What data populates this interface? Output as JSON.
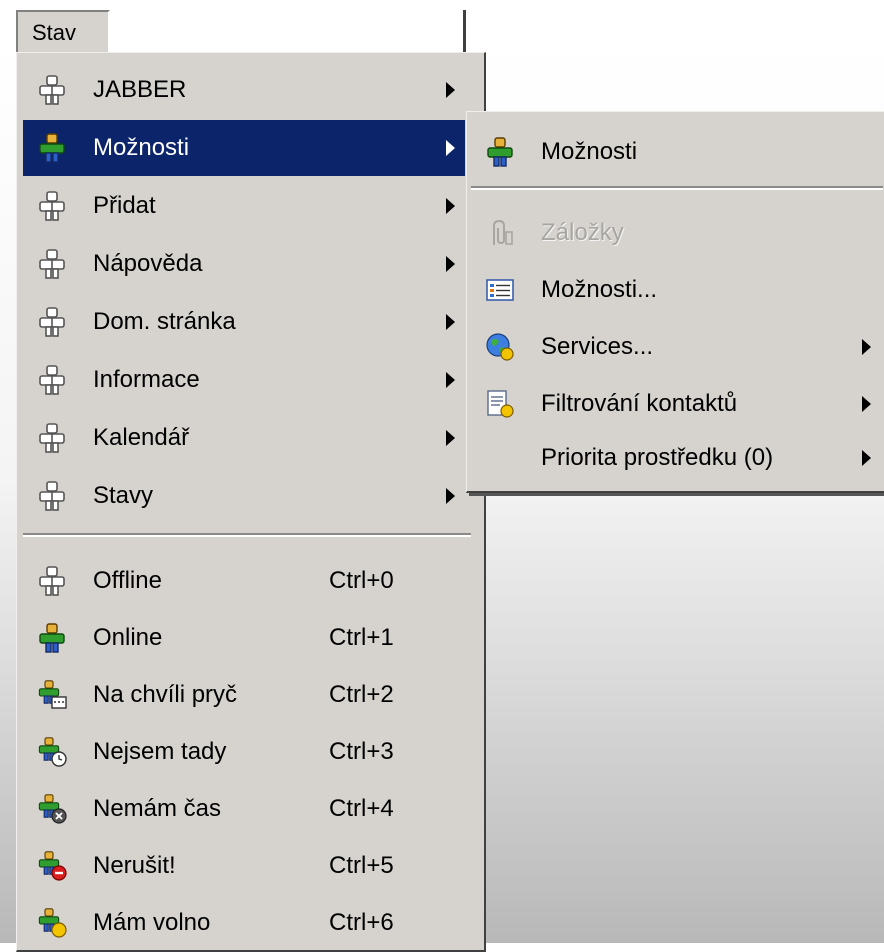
{
  "menubar": {
    "title": "Stav"
  },
  "main_menu": {
    "items": [
      {
        "label": "JABBER",
        "icon": "person-gray-icon",
        "has_submenu": true
      },
      {
        "label": "Možnosti",
        "icon": "person-color-icon",
        "has_submenu": true,
        "selected": true
      },
      {
        "label": "Přidat",
        "icon": "person-gray-icon",
        "has_submenu": true
      },
      {
        "label": "Nápověda",
        "icon": "person-gray-icon",
        "has_submenu": true
      },
      {
        "label": "Dom. stránka",
        "icon": "person-gray-icon",
        "has_submenu": true
      },
      {
        "label": "Informace",
        "icon": "person-gray-icon",
        "has_submenu": true
      },
      {
        "label": "Kalendář",
        "icon": "person-gray-icon",
        "has_submenu": true
      },
      {
        "label": "Stavy",
        "icon": "person-gray-icon",
        "has_submenu": true
      }
    ],
    "status_items": [
      {
        "label": "Offline",
        "shortcut": "Ctrl+0",
        "icon": "status-offline-icon"
      },
      {
        "label": "Online",
        "shortcut": "Ctrl+1",
        "icon": "status-online-icon"
      },
      {
        "label": "Na chvíli pryč",
        "shortcut": "Ctrl+2",
        "icon": "status-away-icon"
      },
      {
        "label": "Nejsem tady",
        "shortcut": "Ctrl+3",
        "icon": "status-extended-away-icon"
      },
      {
        "label": "Nemám čas",
        "shortcut": "Ctrl+4",
        "icon": "status-busy-icon"
      },
      {
        "label": "Nerušit!",
        "shortcut": "Ctrl+5",
        "icon": "status-dnd-icon"
      },
      {
        "label": "Mám volno",
        "shortcut": "Ctrl+6",
        "icon": "status-free-icon"
      }
    ]
  },
  "submenu": {
    "header": {
      "label": "Možnosti",
      "icon": "person-color-icon"
    },
    "items": [
      {
        "label": "Záložky",
        "icon": "paperclip-icon",
        "disabled": true
      },
      {
        "label": "Možnosti...",
        "icon": "options-list-icon"
      },
      {
        "label": "Services...",
        "icon": "globe-services-icon",
        "has_submenu": true
      },
      {
        "label": "Filtrování kontaktů",
        "icon": "filter-document-icon",
        "has_submenu": true
      },
      {
        "label": "Priorita prostředku (0)",
        "icon": "",
        "has_submenu": true
      }
    ]
  },
  "colors": {
    "menu_bg": "#d6d3ce",
    "selection": "#0b246a"
  }
}
